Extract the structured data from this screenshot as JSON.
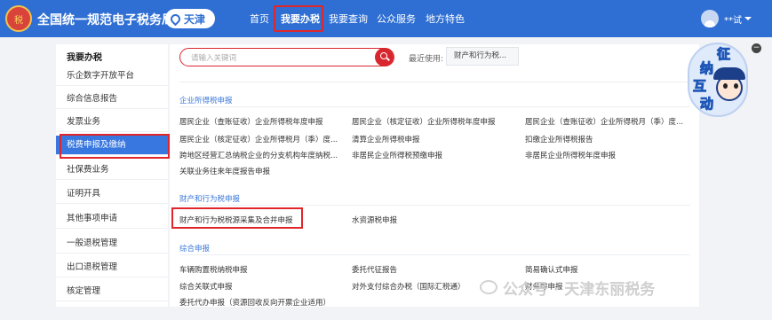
{
  "header": {
    "site_title": "全国统一规范电子税务局",
    "region": "天津",
    "nav": [
      {
        "label": "首页"
      },
      {
        "label": "我要办税"
      },
      {
        "label": "我要查询"
      },
      {
        "label": "公众服务"
      },
      {
        "label": "地方特色"
      }
    ],
    "active_nav": "我要办税",
    "user_name": "**试"
  },
  "sidebar": {
    "title": "我要办税",
    "items": [
      {
        "label": "乐企数字开放平台"
      },
      {
        "label": "综合信息报告"
      },
      {
        "label": "发票业务"
      },
      {
        "label": "税费申报及缴纳"
      },
      {
        "label": "社保费业务"
      },
      {
        "label": "证明开具"
      },
      {
        "label": "其他事项申请"
      },
      {
        "label": "一般退税管理"
      },
      {
        "label": "出口退税管理"
      },
      {
        "label": "核定管理"
      }
    ],
    "active": "税费申报及缴纳"
  },
  "search": {
    "placeholder": "请输入关键词",
    "recent_label": "最近使用:",
    "recent_tag": "财产和行为税..."
  },
  "sections": {
    "corp": {
      "title": "企业所得税申报",
      "items": [
        "居民企业（查账征收）企业所得税年度申报",
        "居民企业（核定征收）企业所得税年度申报",
        "居民企业（查账征收）企业所得税月（季）度...",
        "居民企业（核定征收）企业所得税月（季）度...",
        "清算企业所得税申报",
        "扣缴企业所得税报告",
        "跨地区经营汇总纳税企业的分支机构年度纳税...",
        "非居民企业所得税预缴申报",
        "非居民企业所得税年度申报",
        "关联业务往来年度报告申报"
      ]
    },
    "property": {
      "title": "财产和行为税申报",
      "items": [
        "财产和行为税税源采集及合并申报",
        "水资源税申报"
      ]
    },
    "general": {
      "title": "综合申报",
      "items": [
        "车辆购置税纳税申报",
        "委托代征报告",
        "简易确认式申报",
        "综合关联式申报",
        "对外支付综合办税（国际汇税通）",
        "财务零申报",
        "委托代办申报（资源回收反向开票企业适用）"
      ]
    }
  },
  "mascot": {
    "chars": [
      "征",
      "纳",
      "互",
      "动"
    ]
  },
  "watermark": "公众号 · 天津东丽税务",
  "colors": {
    "header": "#2f6fd3",
    "accent_red": "#e0262b",
    "section_blue": "#3b78d8",
    "active_blue": "#3877df"
  }
}
